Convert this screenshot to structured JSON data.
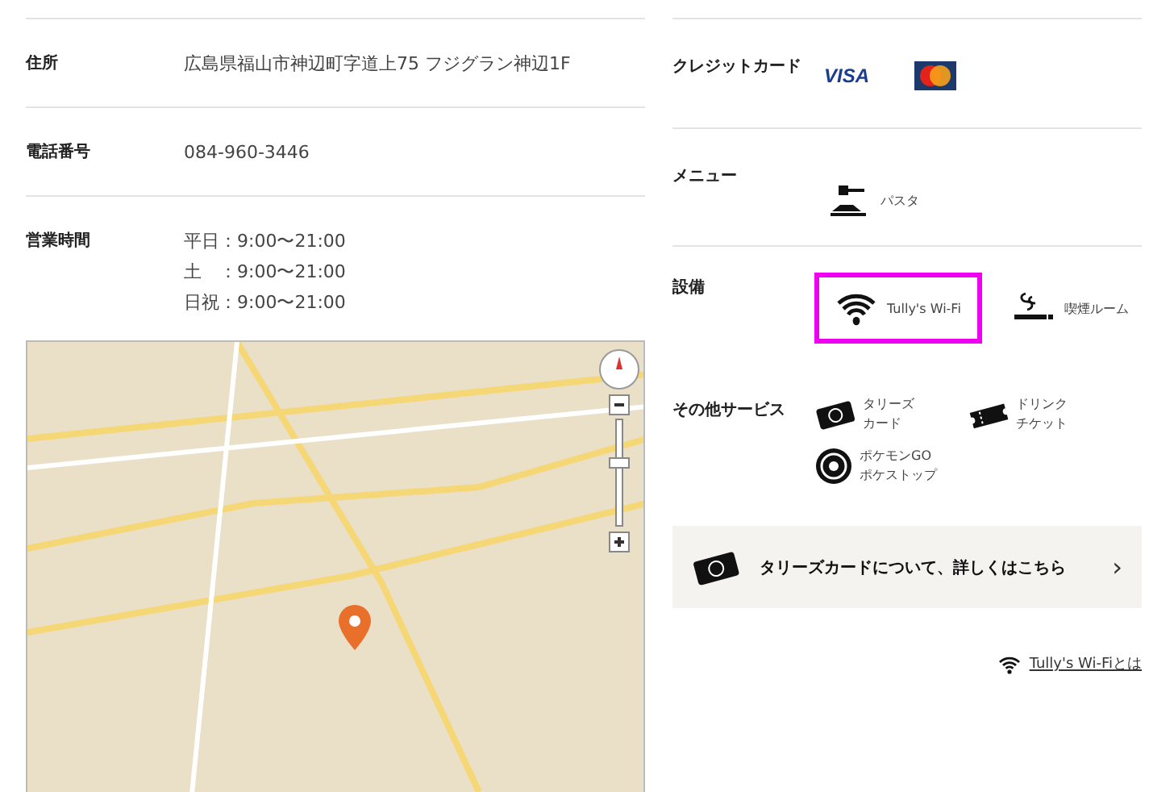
{
  "info_rows": [
    {
      "label": "住所",
      "lines": [
        "広島県福山市神辺町字道上75 フジグラン神辺1F"
      ]
    },
    {
      "label": "電話番号",
      "lines": [
        "084-960-3446"
      ]
    },
    {
      "label": "営業時間",
      "lines": [
        "平日：9:00〜21:00",
        "土　：9:00〜21:00",
        "日祝：9:00〜21:00"
      ]
    }
  ],
  "credit_cards": {
    "label": "クレジットカード",
    "cards": [
      {
        "kind": "visa",
        "text": "VISA"
      },
      {
        "kind": "master"
      }
    ]
  },
  "menu": {
    "label": "メニュー",
    "items": [
      {
        "kind": "pasta",
        "text": "パスタ"
      }
    ]
  },
  "facilities": {
    "label": "設備",
    "items": [
      {
        "kind": "wifi",
        "text": "Tully's Wi-Fi",
        "selected": true
      },
      {
        "kind": "smoking",
        "text": "喫煙ルーム",
        "selected": false
      }
    ]
  },
  "other_services": {
    "label": "その他サービス",
    "items": [
      {
        "kind": "card",
        "lines": [
          "タリーズ",
          "カード"
        ]
      },
      {
        "kind": "ticket",
        "lines": [
          "ドリンク",
          "チケット"
        ]
      },
      {
        "kind": "pokestop",
        "lines": [
          "ポケモンGO",
          "ポケストップ"
        ]
      }
    ]
  },
  "card_banner": {
    "text": "タリーズカードについて、詳しくはこちら",
    "arrow": "›"
  },
  "wifi_link": {
    "text": "Tully's Wi-Fiとは"
  }
}
